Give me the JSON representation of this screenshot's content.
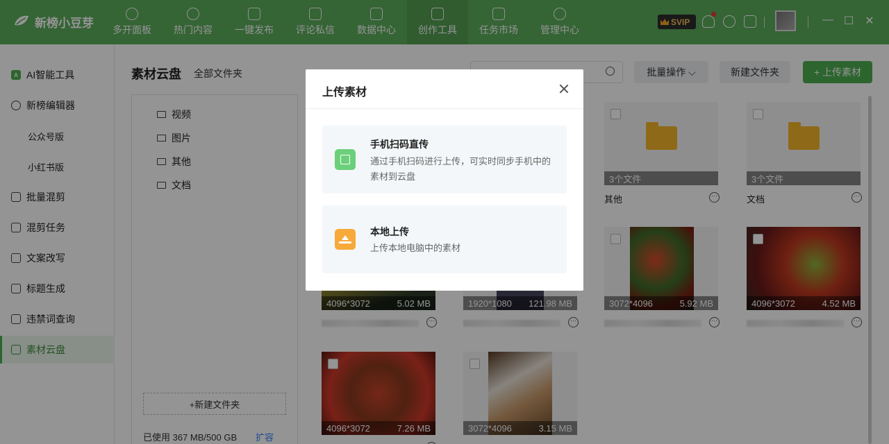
{
  "app": {
    "name": "新榜小豆芽"
  },
  "nav": [
    {
      "label": "多开面板",
      "icon": "person-icon"
    },
    {
      "label": "热门内容",
      "icon": "flame-icon"
    },
    {
      "label": "一键发布",
      "icon": "publish-icon"
    },
    {
      "label": "评论私信",
      "icon": "message-icon"
    },
    {
      "label": "数据中心",
      "icon": "data-icon"
    },
    {
      "label": "创作工具",
      "icon": "toolbox-icon"
    },
    {
      "label": "任务市场",
      "icon": "task-icon"
    },
    {
      "label": "管理中心",
      "icon": "grid-icon"
    }
  ],
  "svip": "SVIP",
  "sidebar": {
    "items": [
      {
        "label": "AI智能工具"
      },
      {
        "label": "新榜编辑器"
      },
      {
        "label": "公众号版"
      },
      {
        "label": "小红书版"
      },
      {
        "label": "批量混剪"
      },
      {
        "label": "混剪任务"
      },
      {
        "label": "文案改写"
      },
      {
        "label": "标题生成"
      },
      {
        "label": "违禁词查询"
      },
      {
        "label": "素材云盘"
      }
    ]
  },
  "main": {
    "title": "素材云盘",
    "breadcrumb": "全部文件夹",
    "search_placeholder": "",
    "batch_label": "批量操作",
    "new_folder_label": "新建文件夹",
    "upload_label": "+ 上传素材"
  },
  "tree": {
    "folders": [
      {
        "label": "视频"
      },
      {
        "label": "图片"
      },
      {
        "label": "其他"
      },
      {
        "label": "文档"
      }
    ],
    "new_folder_label": "+新建文件夹",
    "usage": "已使用 367 MB/500 GB",
    "expand_label": "扩容"
  },
  "cards": {
    "folder_other": {
      "name": "其他",
      "count": "3个文件"
    },
    "folder_docs": {
      "name": "文档",
      "count": "3个文件"
    },
    "img1": {
      "dims": "4096*3072",
      "size": "5.02 MB"
    },
    "img2": {
      "dims": "1920*1080",
      "size": "121.98 MB"
    },
    "img3": {
      "dims": "3072*4096",
      "size": "5.92 MB"
    },
    "img4": {
      "dims": "4096*3072",
      "size": "4.52 MB"
    },
    "img5": {
      "dims": "4096*3072",
      "size": "7.26 MB"
    },
    "img6": {
      "dims": "3072*4096",
      "size": "3.15 MB"
    }
  },
  "modal": {
    "title": "上传素材",
    "scan": {
      "title": "手机扫码直传",
      "desc": "通过手机扫码进行上传，可实时同步手机中的素材到云盘"
    },
    "local": {
      "title": "本地上传",
      "desc": "上传本地电脑中的素材"
    }
  }
}
